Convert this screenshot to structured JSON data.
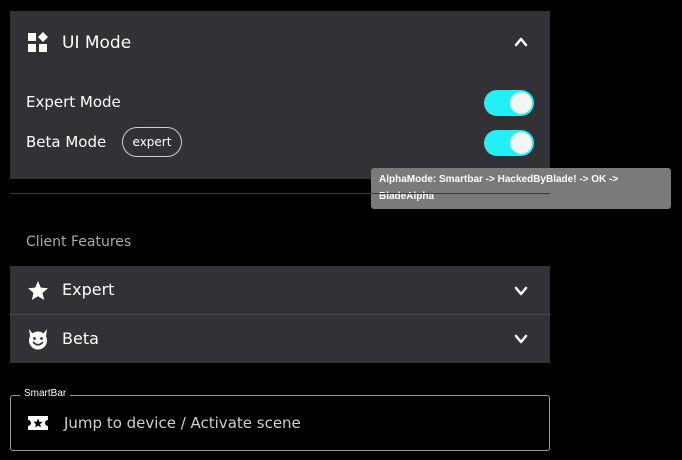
{
  "ui_mode": {
    "title": "UI Mode",
    "icon": "widgets-icon",
    "rows": [
      {
        "label": "Expert Mode",
        "toggle_on": true
      },
      {
        "label": "Beta Mode",
        "toggle_on": true,
        "chip": "expert"
      }
    ]
  },
  "tooltip": {
    "text": "AlphaMode: Smartbar -> HackedByBlade! -> OK -> BladeAlpha"
  },
  "client_features": {
    "title": "Client Features",
    "items": [
      {
        "label": "Expert",
        "icon": "star-icon"
      },
      {
        "label": "Beta",
        "icon": "devil-face-icon"
      }
    ]
  },
  "smartbar": {
    "legend": "SmartBar",
    "placeholder": "Jump to device / Activate scene",
    "icon": "ticket-star-icon"
  },
  "colors": {
    "accent": "#22f0f4",
    "panel": "#323236",
    "background": "#000000"
  }
}
